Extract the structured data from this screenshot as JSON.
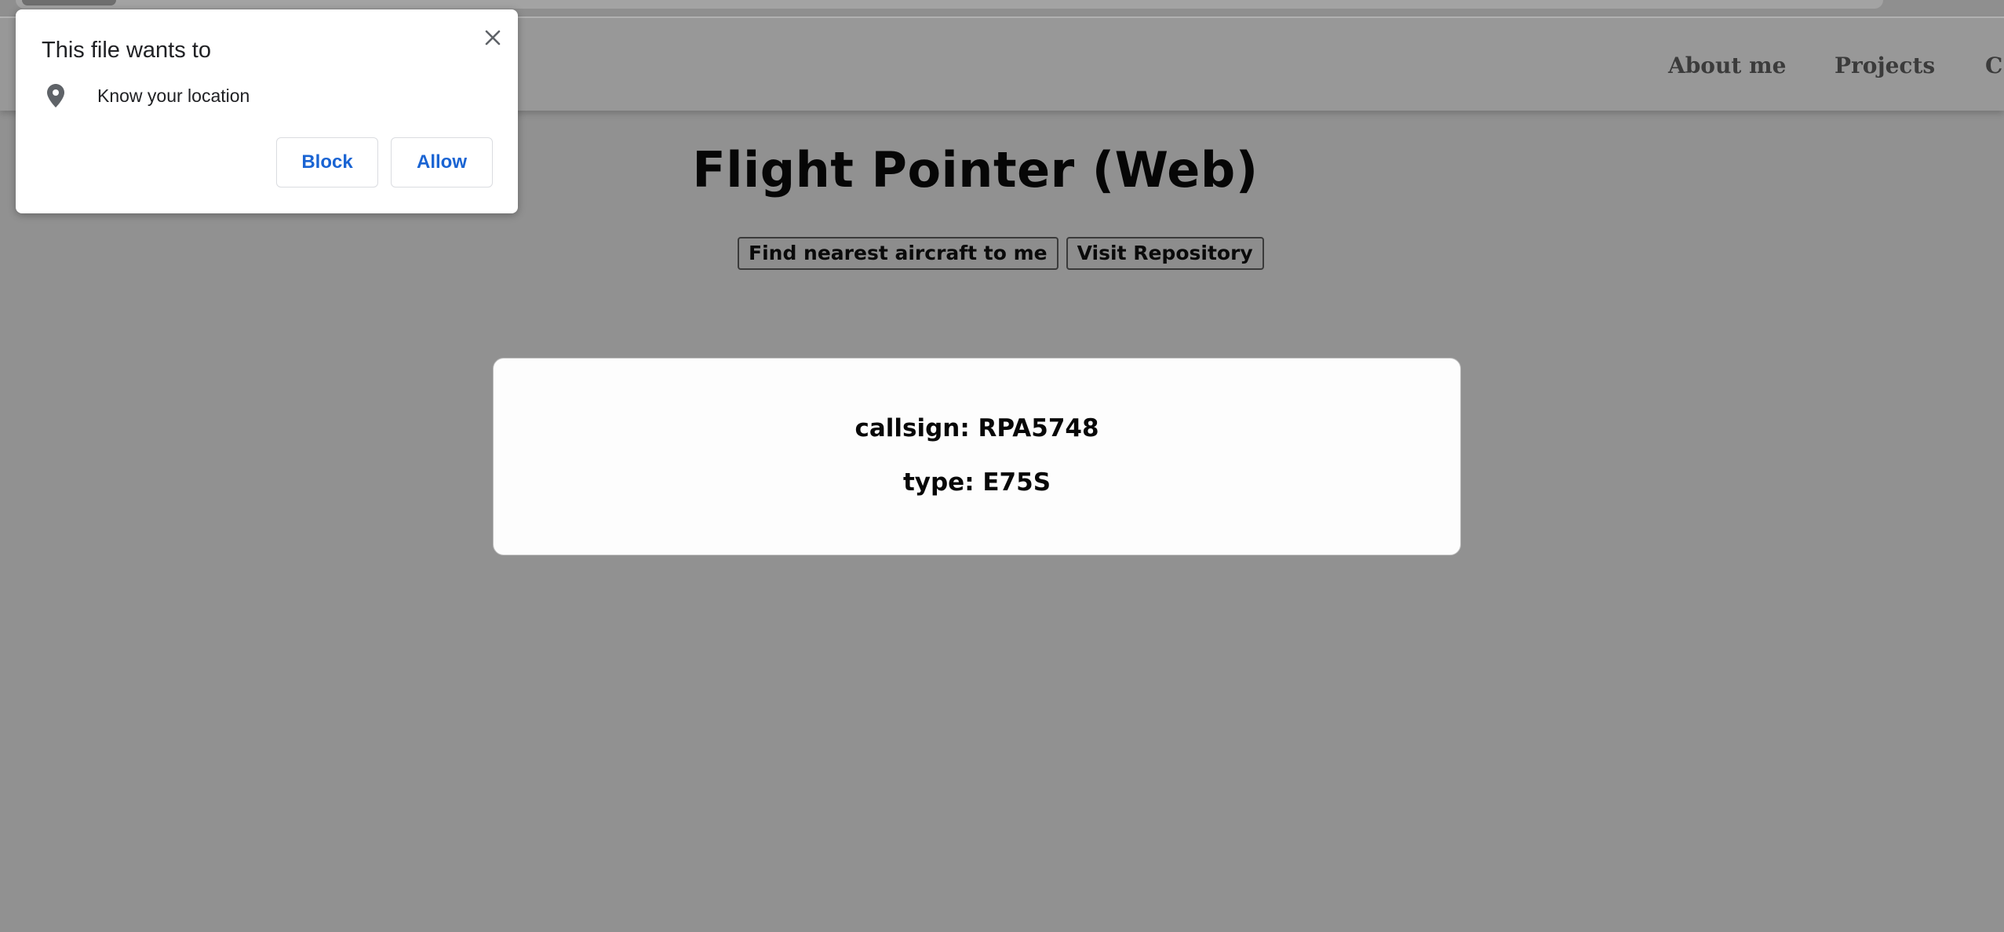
{
  "header": {
    "nav": [
      {
        "label": "About me"
      },
      {
        "label": "Projects"
      },
      {
        "label": "C"
      }
    ]
  },
  "main": {
    "title": "Flight Pointer (Web)",
    "buttons": {
      "find_nearest": "Find nearest aircraft to me",
      "visit_repo": "Visit Repository"
    },
    "card": {
      "callsign": "callsign: RPA5748",
      "type": "type: E75S"
    }
  },
  "permission_popup": {
    "title": "This file wants to",
    "permission_icon": "location-pin-icon",
    "permission_text": "Know your location",
    "block_label": "Block",
    "allow_label": "Allow",
    "close_icon": "close-icon",
    "accent_color": "#1a64d3"
  }
}
